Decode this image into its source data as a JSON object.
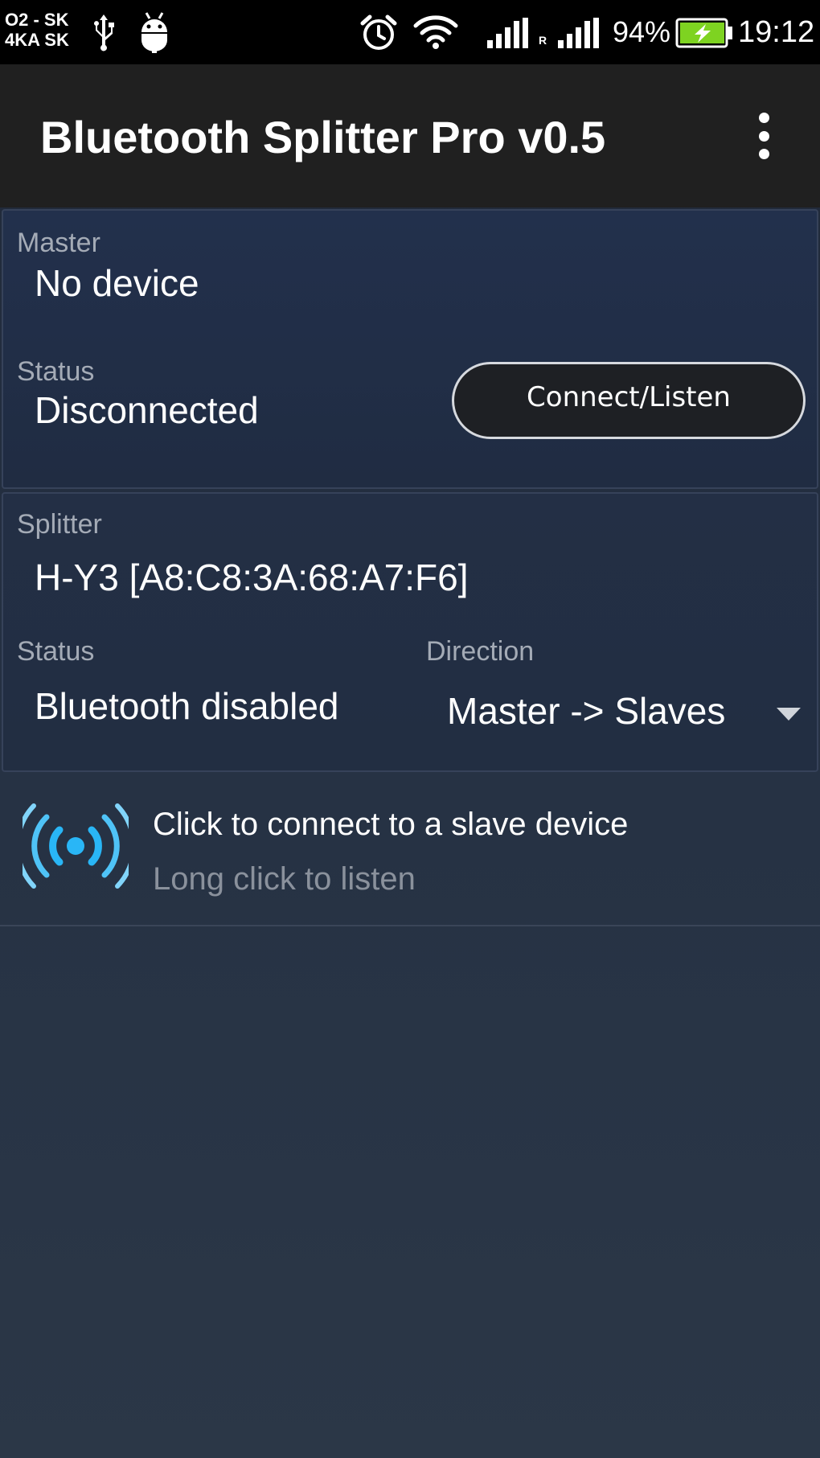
{
  "status_bar": {
    "carrier_line1": "O2 - SK",
    "carrier_line2": "4KA SK",
    "roaming_indicator": "R",
    "battery_percent": "94%",
    "time": "19:12",
    "icons": [
      "usb-icon",
      "android-debug-icon",
      "alarm-icon",
      "wifi-icon",
      "signal-icon",
      "signal-icon",
      "battery-charging-icon"
    ],
    "battery_color": "#7ed321"
  },
  "action_bar": {
    "title": "Bluetooth Splitter Pro v0.5",
    "menu_icon": "overflow-menu-icon"
  },
  "master": {
    "section_label": "Master",
    "device": "No device",
    "status_label": "Status",
    "status": "Disconnected",
    "button_label": "Connect/Listen"
  },
  "splitter": {
    "section_label": "Splitter",
    "device": "H-Y3 [A8:C8:3A:68:A7:F6]",
    "status_label": "Status",
    "status": "Bluetooth disabled",
    "direction_label": "Direction",
    "direction_selected": "Master -> Slaves"
  },
  "slave_item": {
    "icon": "broadcast-icon",
    "primary_text": "Click to connect to a slave device",
    "secondary_text": "Long click to listen",
    "icon_color": "#29b6f6"
  },
  "colors": {
    "background": "#263244",
    "action_bar": "#202020",
    "label_text": "#a4abb6",
    "button_border": "#d6d9de"
  }
}
